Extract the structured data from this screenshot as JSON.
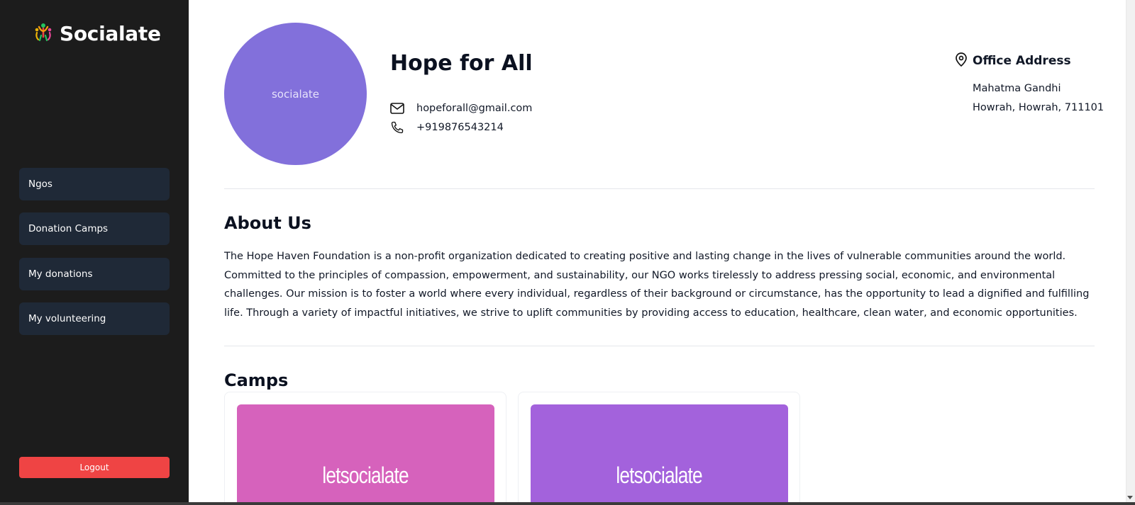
{
  "sidebar": {
    "brand": "Socialate",
    "logo_icon": "people-celebrate-icon",
    "items": [
      {
        "label": "Ngos"
      },
      {
        "label": "Donation Camps"
      },
      {
        "label": "My donations"
      },
      {
        "label": "My volunteering"
      }
    ],
    "logout_label": "Logout"
  },
  "profile": {
    "avatar_text": "socialate",
    "name": "Hope for All",
    "email": "hopeforall@gmail.com",
    "phone": "+919876543214",
    "address_title": "Office Address",
    "address_line1": "Mahatma Gandhi",
    "address_line2": "Howrah, Howrah, 711101"
  },
  "about": {
    "title": "About Us",
    "text": "The Hope Haven Foundation is a non-profit organization dedicated to creating positive and lasting change in the lives of vulnerable communities around the world. Committed to the principles of compassion, empowerment, and sustainability, our NGO works tirelessly to address pressing social, economic, and environmental challenges. Our mission is to foster a world where every individual, regardless of their background or circumstance, has the opportunity to lead a dignified and fulfilling life. Through a variety of impactful initiatives, we strive to uplift communities by providing access to education, healthcare, clean water, and economic opportunities."
  },
  "camps": {
    "title": "Camps",
    "items": [
      {
        "image_text": "letsocialate",
        "color": "#d662bc"
      },
      {
        "image_text": "letsocialate",
        "color": "#a362dc"
      }
    ]
  },
  "colors": {
    "sidebar_bg": "#1c1c1c",
    "nav_item_bg": "#1f2937",
    "logout_bg": "#ef4444",
    "avatar_bg": "#8270db"
  }
}
